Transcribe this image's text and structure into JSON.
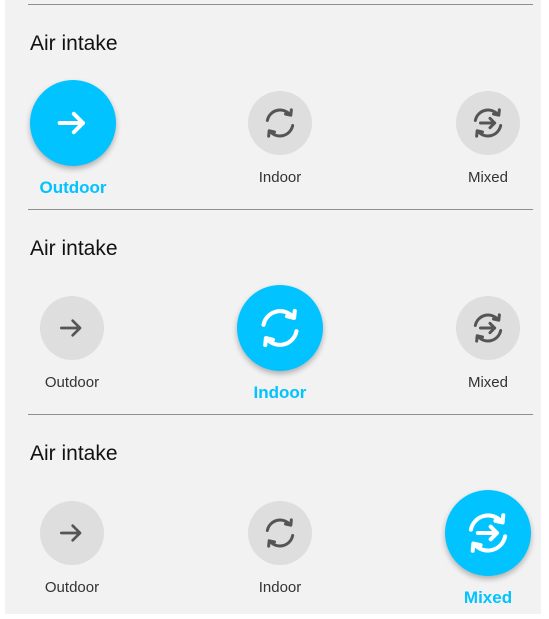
{
  "sections": [
    {
      "title": "Air intake",
      "options": [
        {
          "label": "Outdoor",
          "icon": "arrow-right-icon",
          "selected": true
        },
        {
          "label": "Indoor",
          "icon": "recirculate-icon",
          "selected": false
        },
        {
          "label": "Mixed",
          "icon": "mixed-air-icon",
          "selected": false
        }
      ]
    },
    {
      "title": "Air intake",
      "options": [
        {
          "label": "Outdoor",
          "icon": "arrow-right-icon",
          "selected": false
        },
        {
          "label": "Indoor",
          "icon": "recirculate-icon",
          "selected": true
        },
        {
          "label": "Mixed",
          "icon": "mixed-air-icon",
          "selected": false
        }
      ]
    },
    {
      "title": "Air intake",
      "options": [
        {
          "label": "Outdoor",
          "icon": "arrow-right-icon",
          "selected": false
        },
        {
          "label": "Indoor",
          "icon": "recirculate-icon",
          "selected": false
        },
        {
          "label": "Mixed",
          "icon": "mixed-air-icon",
          "selected": true
        }
      ]
    }
  ],
  "colors": {
    "accent": "#00c3ff",
    "inactive_circle": "#dedede",
    "inactive_icon": "#555555",
    "panel_bg": "#f2f2f2"
  }
}
